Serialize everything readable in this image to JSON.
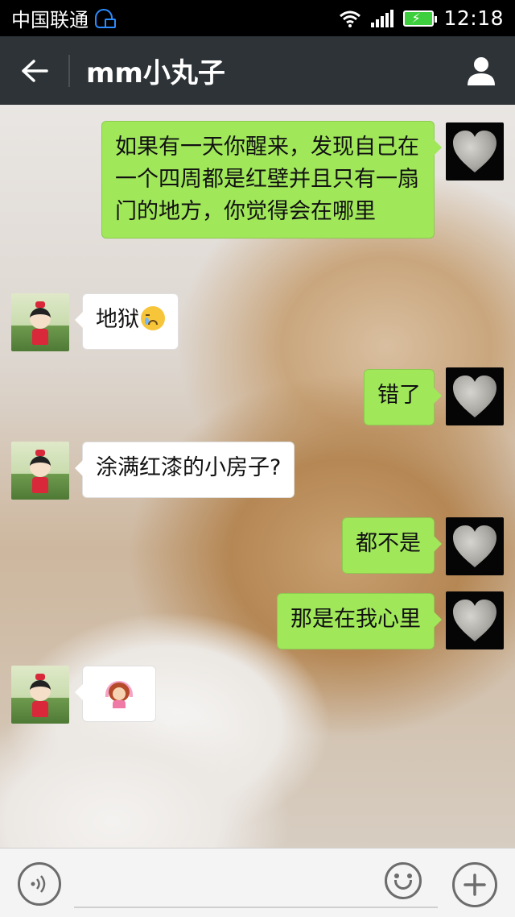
{
  "status_bar": {
    "carrier": "中国联通",
    "time": "12:18",
    "icons": [
      "carrier-hd-icon",
      "wifi-icon",
      "signal-icon",
      "battery-charging-icon"
    ]
  },
  "header": {
    "back_icon": "back-arrow-icon",
    "title": "mm小丸子",
    "profile_icon": "person-icon"
  },
  "messages": [
    {
      "sender": "me",
      "text": "如果有一天你醒来，发现自己在一个四周都是红壁并且只有一扇门的地方，你觉得会在哪里",
      "avatar": "heart-moon-avatar"
    },
    {
      "sender": "her",
      "text": "地狱",
      "emoji": "crying-face-emoji",
      "avatar": "girl-avatar"
    },
    {
      "sender": "me",
      "text": "错了",
      "avatar": "heart-moon-avatar"
    },
    {
      "sender": "her",
      "text": "涂满红漆的小房子?",
      "avatar": "girl-avatar"
    },
    {
      "sender": "me",
      "text": "都不是",
      "avatar": "heart-moon-avatar"
    },
    {
      "sender": "me",
      "text": "那是在我心里",
      "avatar": "heart-moon-avatar"
    },
    {
      "sender": "her",
      "text": "",
      "emoji": "woman-ok-gesture-emoji",
      "avatar": "girl-avatar"
    }
  ],
  "input_bar": {
    "voice_icon": "voice-icon",
    "input_value": "",
    "emoji_icon": "emoji-icon",
    "plus_icon": "plus-icon"
  },
  "colors": {
    "header_bg": "#2d3337",
    "my_bubble": "#a0e75a",
    "her_bubble": "#ffffff",
    "status_bg": "#000000"
  }
}
